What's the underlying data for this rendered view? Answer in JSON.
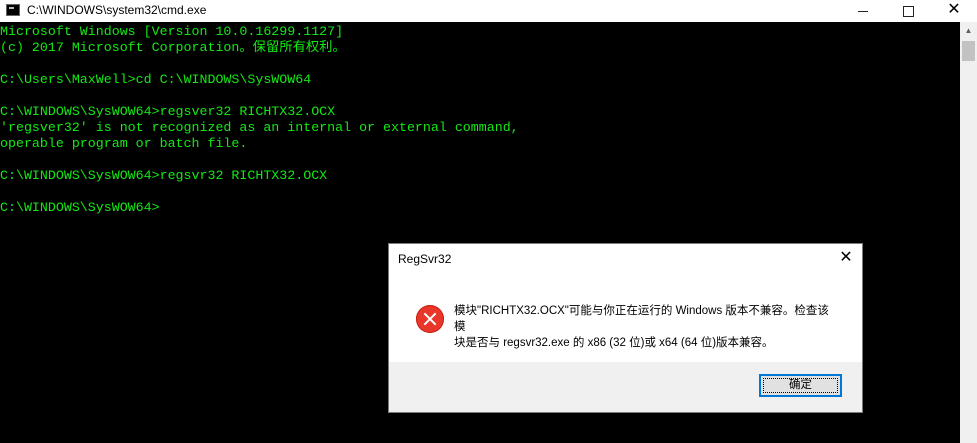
{
  "window": {
    "title": "C:\\WINDOWS\\system32\\cmd.exe",
    "close_glyph": "✕"
  },
  "scrollbar": {
    "up_glyph": "▲"
  },
  "console": {
    "lines": [
      "Microsoft Windows [Version 10.0.16299.1127]",
      "(c) 2017 Microsoft Corporation。保留所有权利。",
      "",
      "C:\\Users\\MaxWell>cd C:\\WINDOWS\\SysWOW64",
      "",
      "C:\\WINDOWS\\SysWOW64>regsver32 RICHTX32.OCX",
      "'regsver32' is not recognized as an internal or external command,",
      "operable program or batch file.",
      "",
      "C:\\WINDOWS\\SysWOW64>regsvr32 RICHTX32.OCX",
      "",
      "C:\\WINDOWS\\SysWOW64>"
    ]
  },
  "dialog": {
    "title": "RegSvr32",
    "close_glyph": "✕",
    "message_line1": "模块\"RICHTX32.OCX\"可能与你正在运行的 Windows 版本不兼容。检查该模",
    "message_line2": "块是否与 regsvr32.exe 的 x86 (32 位)或 x64 (64 位)版本兼容。",
    "ok_label": "确定"
  },
  "colors": {
    "console_text": "#13e913",
    "console_bg": "#000000",
    "ok_border": "#0078d7",
    "error_icon": "#e8372a"
  },
  "icons": {
    "app": "cmd-icon",
    "dialog": "error-icon"
  }
}
